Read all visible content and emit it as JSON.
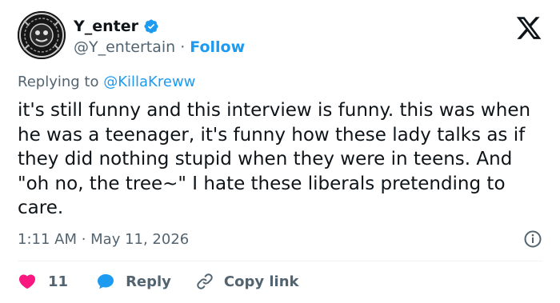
{
  "author": {
    "display_name": "Y_enter",
    "handle": "@Y_entertain",
    "separator": "·",
    "follow_label": "Follow"
  },
  "reply_context": {
    "prefix": "Replying to",
    "handle": "@KillaKreww"
  },
  "tweet": {
    "text": "it's still funny and this interview is funny. this was when he was a teenager, it's funny how these lady talks as if they did nothing stupid when they were in teens. And \"oh no, the tree~\" I hate these liberals pretending to care.",
    "timestamp": "1:11 AM · May 11, 2026"
  },
  "actions": {
    "like_count": "11",
    "reply_label": "Reply",
    "copy_link_label": "Copy link"
  },
  "colors": {
    "accent": "#1d9bf0",
    "like": "#f91880",
    "muted": "#536471",
    "text": "#0f1419"
  },
  "icons": {
    "logo": "x-logo-icon",
    "verified": "verified-badge-icon",
    "info": "info-icon",
    "like": "heart-icon",
    "reply": "speech-bubble-icon",
    "copy": "link-icon"
  }
}
